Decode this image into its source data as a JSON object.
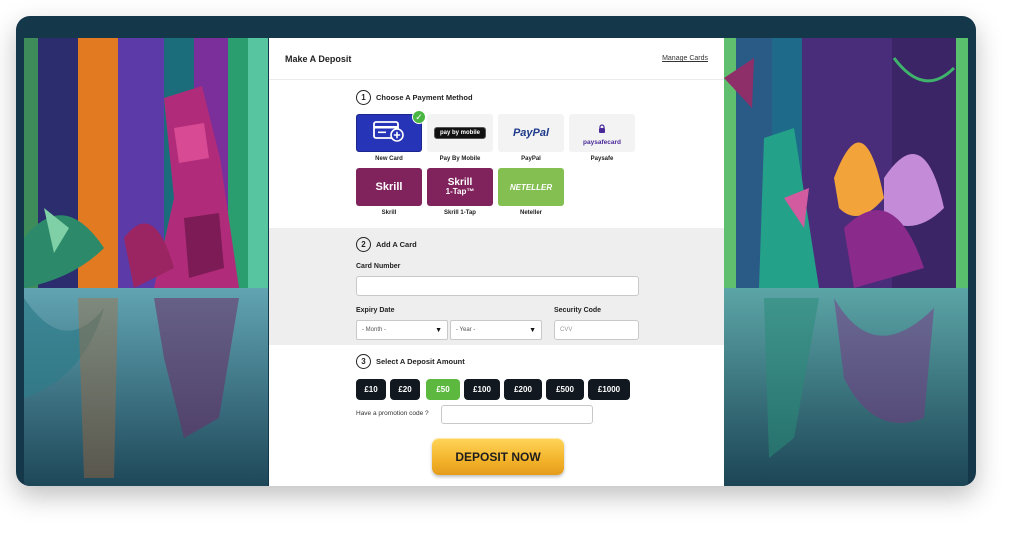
{
  "panel": {
    "title": "Make A Deposit",
    "manage_cards": "Manage Cards"
  },
  "step1": {
    "number": "1",
    "label": "Choose A Payment Method",
    "methods": [
      {
        "caption": "New Card",
        "selected": true,
        "icon": "credit-card-add-icon"
      },
      {
        "caption": "Pay By Mobile",
        "logo": "pay by mobile"
      },
      {
        "caption": "PayPal",
        "logo": "PayPal"
      },
      {
        "caption": "Paysafe",
        "logo": "paysafecard"
      },
      {
        "caption": "Skrill",
        "logo": "Skrill"
      },
      {
        "caption": "Skrill 1-Tap",
        "logo_line1": "Skrill",
        "logo_line2": "1-Tap™"
      },
      {
        "caption": "Neteller",
        "logo": "NETELLER"
      }
    ],
    "selected_check": "✓"
  },
  "step2": {
    "number": "2",
    "label": "Add A Card",
    "card_number_label": "Card Number",
    "expiry_label": "Expiry Date",
    "month_placeholder": "- Month -",
    "year_placeholder": "- Year -",
    "security_label": "Security Code",
    "cvv_placeholder": "CVV"
  },
  "step3": {
    "number": "3",
    "label": "Select A Deposit Amount",
    "amounts": [
      "£10",
      "£20",
      "£50",
      "£100",
      "£200",
      "£500",
      "£1000"
    ],
    "selected_amount": "£50",
    "promo_label": "Have a promotion code ?"
  },
  "deposit_button": "DEPOSIT NOW",
  "colors": {
    "selected_blue": "#2634b8",
    "skrill": "#80235d",
    "neteller": "#84bf52",
    "amount_active": "#5cb83f",
    "amount_default": "#111820",
    "deposit_gold": "#f3b32a"
  }
}
